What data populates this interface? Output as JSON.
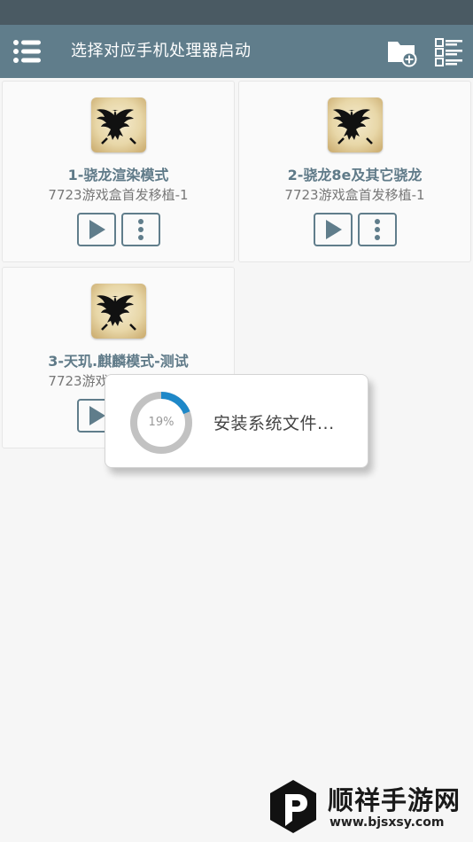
{
  "header": {
    "title": "选择对应手机处理器启动",
    "menu_icon": "menu-icon",
    "folder_icon": "folder-add-icon",
    "list_icon": "list-view-icon"
  },
  "containers": [
    {
      "name": "1-骁龙渲染模式",
      "subtitle": "7723游戏盒首发移植-1",
      "icon": "eagle-emblem-icon"
    },
    {
      "name": "2-骁龙8e及其它骁龙",
      "subtitle": "7723游戏盒首发移植-1",
      "icon": "eagle-emblem-icon"
    },
    {
      "name": "3-天玑.麒麟模式-测试",
      "subtitle": "7723游戏盒首发移植-1",
      "icon": "eagle-emblem-icon"
    }
  ],
  "progress_dialog": {
    "percent_label": "19%",
    "percent_value": 0.19,
    "message": "安装系统文件..."
  },
  "watermark": {
    "name": "顺祥手游网",
    "url": "www.bjsxsy.com"
  },
  "colors": {
    "status_bar": "#4a5a63",
    "app_bar": "#607d8b",
    "card_title": "#5f7a88",
    "progress_accent": "#1e88c8",
    "progress_track": "#c2c2c2"
  }
}
